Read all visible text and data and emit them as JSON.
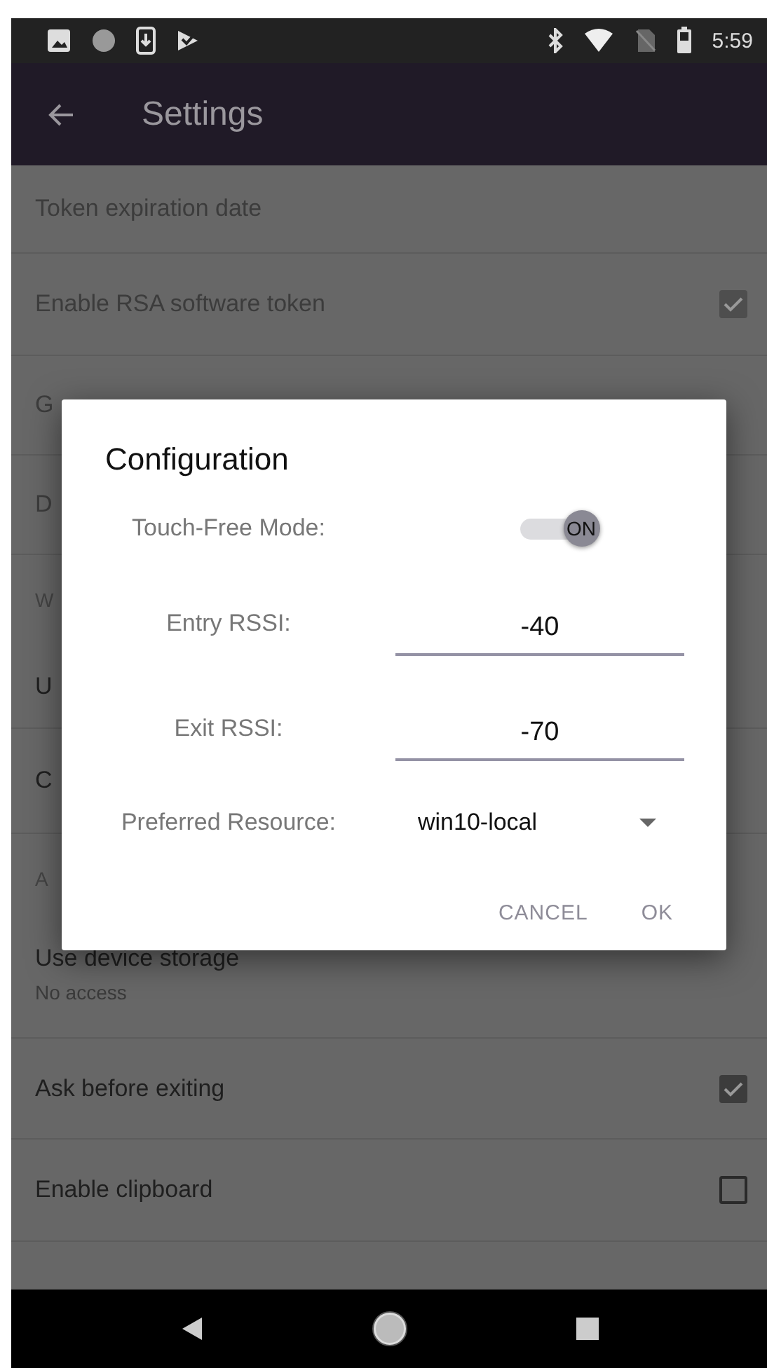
{
  "status_bar": {
    "time": "5:59"
  },
  "app_bar": {
    "title": "Settings"
  },
  "settings": [
    {
      "kind": "item",
      "title": "Token expiration date",
      "disabled": true
    },
    {
      "kind": "checkbox",
      "title": "Enable RSA software token",
      "disabled": true,
      "checked": true
    },
    {
      "kind": "item",
      "title": "G",
      "disabled": true
    },
    {
      "kind": "item",
      "title": "D",
      "disabled": true
    },
    {
      "kind": "header",
      "title": "W"
    },
    {
      "kind": "item",
      "title": "U",
      "disabled": false
    },
    {
      "kind": "item",
      "title": "C",
      "disabled": false
    },
    {
      "kind": "header",
      "title": "A"
    },
    {
      "kind": "item",
      "title": "Use device storage",
      "summary": "No access",
      "disabled": false
    },
    {
      "kind": "checkbox",
      "title": "Ask before exiting",
      "disabled": false,
      "checked": true
    },
    {
      "kind": "checkbox",
      "title": "Enable clipboard",
      "disabled": false,
      "checked": false
    }
  ],
  "dialog": {
    "title": "Configuration",
    "rows": [
      {
        "kind": "toggle",
        "label": "Touch-Free Mode:",
        "on": true,
        "text": "ON"
      },
      {
        "kind": "field",
        "label": "Entry RSSI:",
        "value": "-40"
      },
      {
        "kind": "field",
        "label": "Exit RSSI:",
        "value": "-70"
      },
      {
        "kind": "dropdown",
        "label": "Preferred Resource:",
        "value": "win10-local"
      }
    ],
    "buttons": [
      "CANCEL",
      "OK"
    ]
  }
}
